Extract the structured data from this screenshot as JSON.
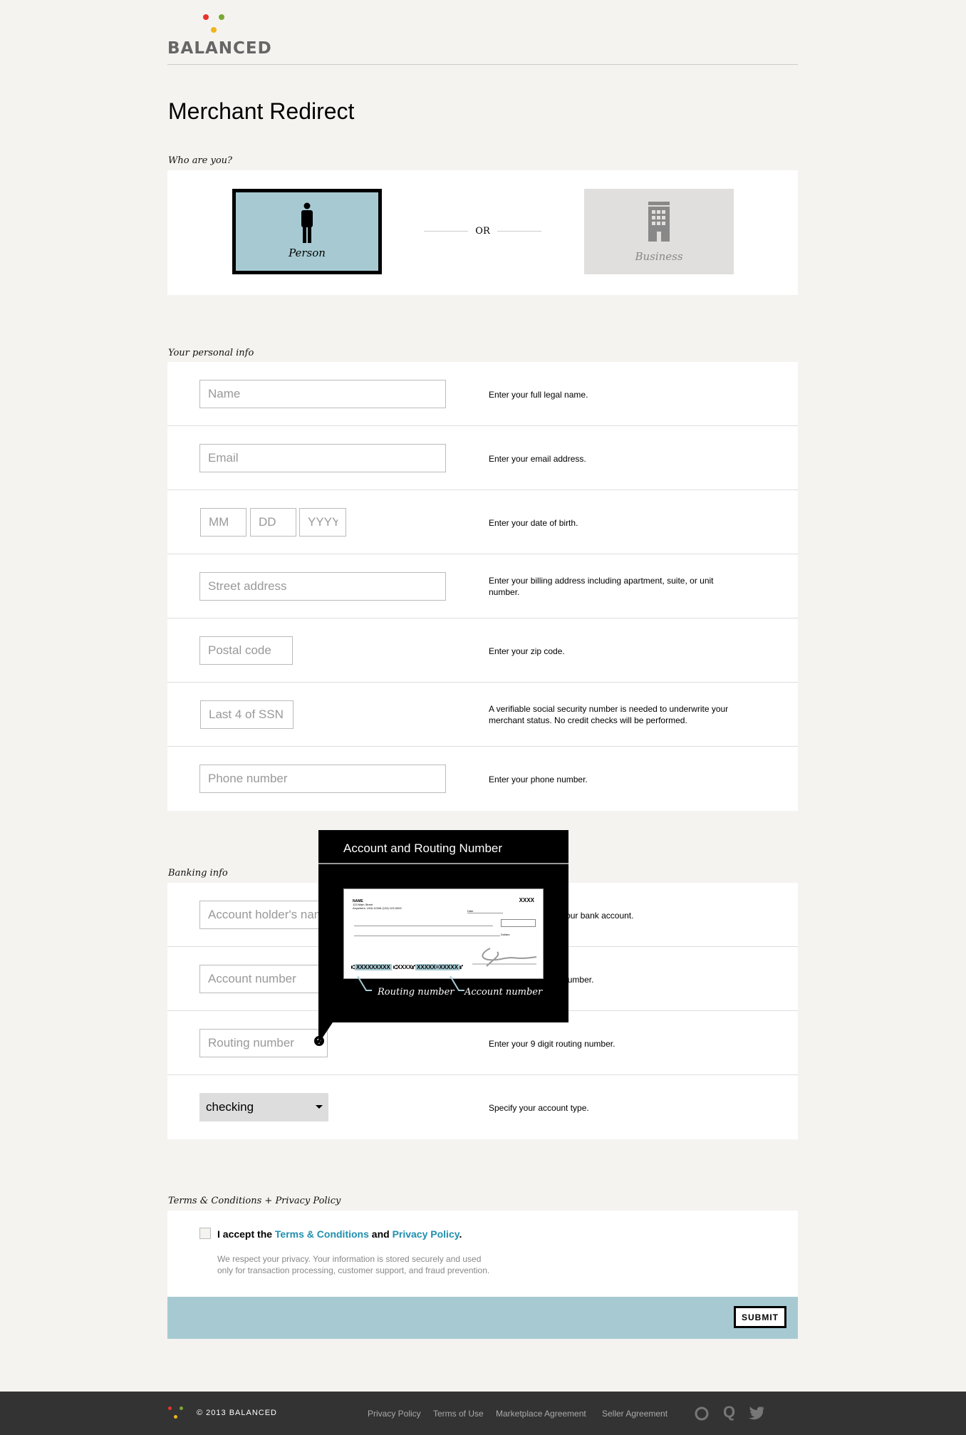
{
  "brand": {
    "name": "BALANCED",
    "dot_colors": [
      "#e8322b",
      "#7aa832",
      "#f0b41c"
    ]
  },
  "page_title": "Merchant Redirect",
  "who": {
    "label": "Who are you?",
    "person": "Person",
    "or": "OR",
    "business": "Business",
    "selected": "Person",
    "selected_color": "#a7cad2"
  },
  "personal": {
    "label": "Your personal info",
    "fields": [
      {
        "placeholder": "Name",
        "help": "Enter your full legal name."
      },
      {
        "placeholder": "Email",
        "help": "Enter your email address."
      },
      {
        "placeholder_mm": "MM",
        "placeholder_dd": "DD",
        "placeholder_yyyy": "YYYY",
        "help": "Enter your date of birth."
      },
      {
        "placeholder": "Street address",
        "help": "Enter your billing address including apartment, suite, or unit number."
      },
      {
        "placeholder": "Postal code",
        "help": "Enter your zip code."
      },
      {
        "placeholder": "Last 4 of SSN",
        "help": "A verifiable social security number is needed to underwrite your merchant status. No credit checks will be performed."
      },
      {
        "placeholder": "Phone number",
        "help": "Enter your phone number."
      }
    ]
  },
  "banking": {
    "label": "Banking info",
    "fields": [
      {
        "placeholder": "Account holder's name",
        "help": "Enter the name on your bank account."
      },
      {
        "placeholder": "Account number",
        "help": "Enter your account number."
      },
      {
        "placeholder": "Routing number",
        "help": "Enter your 9 digit routing number."
      },
      {
        "value": "checking",
        "help": "Specify your account type."
      }
    ]
  },
  "tooltip": {
    "title": "Account and Routing Number",
    "check": {
      "name": "NAME",
      "address1": "123 Main Street",
      "address2": "Anywhere, USA 12345 (123) 123-0000",
      "number": "XXXX",
      "date": "Date",
      "dollars": "Dollars",
      "routing": "XXXXXXXXX",
      "mid": "XXXX",
      "account": "XXXXX=XXXXX"
    },
    "routing_label": "Routing number",
    "account_label": "Account number"
  },
  "terms": {
    "label": "Terms & Conditions + Privacy Policy",
    "accept_prefix": "I accept the",
    "terms_link": "Terms & Conditions",
    "and": "and",
    "privacy_link": "Privacy Policy",
    "period": ".",
    "privacy_note_1": "We respect your privacy. Your information is stored securely and used",
    "privacy_note_2": "only for transaction processing, customer support, and fraud prevention.",
    "accepted": false
  },
  "submit": "SUBMIT",
  "footer": {
    "copyright": "© 2013 BALANCED",
    "links": [
      "Privacy Policy",
      "Terms of Use",
      "Marketplace Agreement",
      "Seller Agreement"
    ],
    "icons": [
      "github-icon",
      "quora-icon",
      "twitter-icon"
    ]
  }
}
